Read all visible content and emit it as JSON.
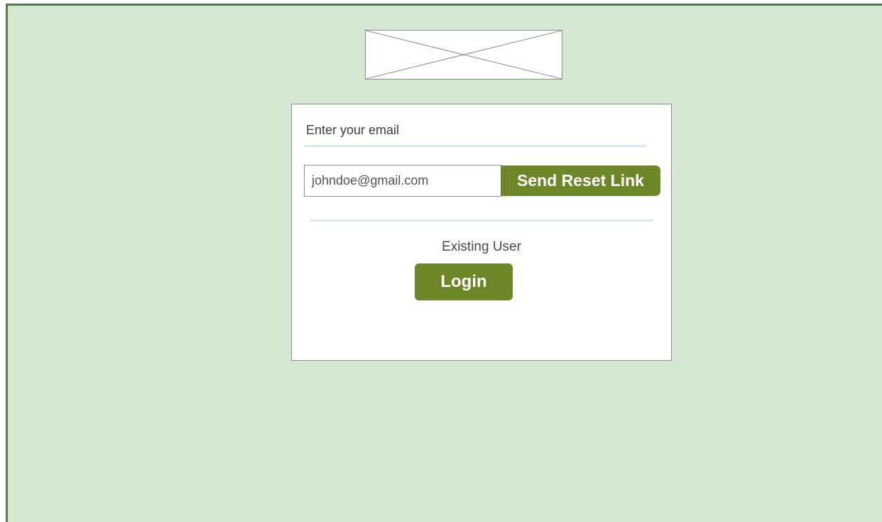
{
  "logo": {
    "icon": "image-placeholder-icon"
  },
  "reset_form": {
    "label": "Enter your email",
    "email_value": "johndoe@gmail.com",
    "send_button_label": "Send Reset Link"
  },
  "existing_user": {
    "label": "Existing User",
    "login_button_label": "Login"
  },
  "colors": {
    "background": "#d5e8d4",
    "frame_border": "#5b7a4a",
    "button": "#6d8628",
    "divider": "#dbe9fa"
  }
}
